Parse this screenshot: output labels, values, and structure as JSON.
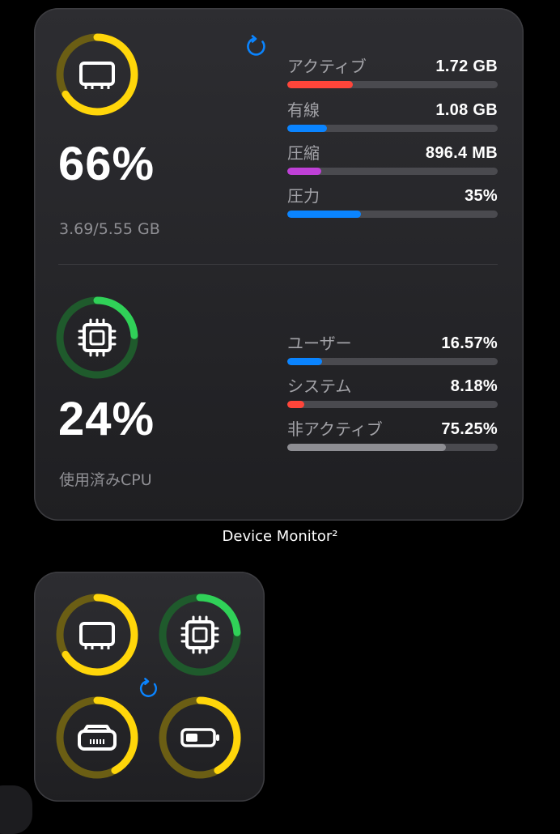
{
  "memory": {
    "percent": "66%",
    "fraction": 0.66,
    "detail": "3.69/5.55 GB",
    "ring_color": "#ffd60a",
    "ring_track": "#6b5e14",
    "icon": "memory-chip-icon",
    "metrics": [
      {
        "label": "アクティブ",
        "value": "1.72 GB",
        "fraction": 0.31,
        "color": "#ff453a"
      },
      {
        "label": "有線",
        "value": "1.08 GB",
        "fraction": 0.19,
        "color": "#0a84ff"
      },
      {
        "label": "圧縮",
        "value": "896.4 MB",
        "fraction": 0.16,
        "color": "#bf40d7"
      },
      {
        "label": "圧力",
        "value": "35%",
        "fraction": 0.35,
        "color": "#0a84ff"
      }
    ]
  },
  "cpu": {
    "percent": "24%",
    "fraction": 0.24,
    "detail": "使用済みCPU",
    "ring_color": "#30d158",
    "ring_track": "#1f5a2c",
    "icon": "cpu-icon",
    "metrics": [
      {
        "label": "ユーザー",
        "value": "16.57%",
        "fraction": 0.1657,
        "color": "#0a84ff"
      },
      {
        "label": "システム",
        "value": "8.18%",
        "fraction": 0.0818,
        "color": "#ff453a"
      },
      {
        "label": "非アクティブ",
        "value": "75.25%",
        "fraction": 0.7525,
        "color": "#8e8e93"
      }
    ]
  },
  "widget_caption": "Device Monitor²",
  "accent_color": "#0a84ff",
  "refresh_icon": "refresh-icon",
  "small_widget": {
    "rings": [
      {
        "name": "memory",
        "icon": "memory-chip-icon",
        "fraction": 0.66,
        "color": "#ffd60a",
        "track": "#6b5e14"
      },
      {
        "name": "cpu",
        "icon": "cpu-icon",
        "fraction": 0.24,
        "color": "#30d158",
        "track": "#1f5a2c"
      },
      {
        "name": "storage",
        "icon": "storage-drive-icon",
        "fraction": 0.42,
        "color": "#ffd60a",
        "track": "#6b5e14"
      },
      {
        "name": "battery",
        "icon": "battery-icon",
        "fraction": 0.42,
        "color": "#ffd60a",
        "track": "#6b5e14"
      }
    ]
  }
}
